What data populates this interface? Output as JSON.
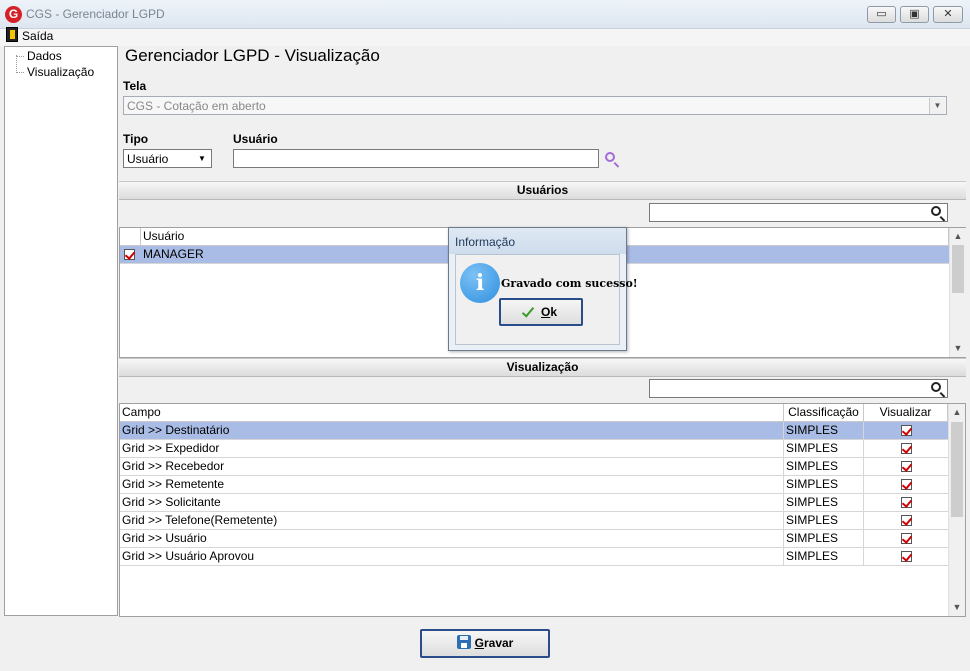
{
  "window": {
    "title": "CGS - Gerenciador LGPD",
    "app_icon_letter": "G",
    "controls": {
      "minimize": "▭",
      "maximize": "▣",
      "close": "✕"
    }
  },
  "menu": {
    "exit_label": "Saída"
  },
  "tree": {
    "items": [
      {
        "label": "Dados"
      },
      {
        "label": "Visualização"
      }
    ]
  },
  "main": {
    "title": "Gerenciador LGPD - Visualização",
    "tela": {
      "label": "Tela",
      "value": "CGS - Cotação em aberto"
    },
    "tipo": {
      "label": "Tipo",
      "value": "Usuário"
    },
    "usuario": {
      "label": "Usuário",
      "value": ""
    }
  },
  "usuarios_section": {
    "header": "Usuários",
    "search_value": "",
    "columns": [
      "Usuário"
    ],
    "rows": [
      {
        "checked": true,
        "name": "MANAGER",
        "selected": true
      }
    ]
  },
  "visualizacao_section": {
    "header": "Visualização",
    "search_value": "",
    "columns": [
      "Campo",
      "Classificação",
      "Visualizar"
    ],
    "rows": [
      {
        "campo": "Grid >> Destinatário",
        "classificacao": "SIMPLES",
        "visualizar": true,
        "selected": true
      },
      {
        "campo": "Grid >> Expedidor",
        "classificacao": "SIMPLES",
        "visualizar": true
      },
      {
        "campo": "Grid >> Recebedor",
        "classificacao": "SIMPLES",
        "visualizar": true
      },
      {
        "campo": "Grid >> Remetente",
        "classificacao": "SIMPLES",
        "visualizar": true
      },
      {
        "campo": "Grid >> Solicitante",
        "classificacao": "SIMPLES",
        "visualizar": true
      },
      {
        "campo": "Grid >> Telefone(Remetente)",
        "classificacao": "SIMPLES",
        "visualizar": true
      },
      {
        "campo": "Grid >> Usuário",
        "classificacao": "SIMPLES",
        "visualizar": true
      },
      {
        "campo": "Grid >> Usuário Aprovou",
        "classificacao": "SIMPLES",
        "visualizar": true
      }
    ]
  },
  "dialog": {
    "title": "Informação",
    "message": "Gravado com sucesso!",
    "icon": "i",
    "ok_label_underlined": "O",
    "ok_label_rest": "k"
  },
  "footer": {
    "save_label_underlined": "G",
    "save_label_rest": "ravar"
  },
  "colors": {
    "selection": "#a9bce5",
    "check_red": "#d00000",
    "button_border": "#2b4c8a"
  }
}
